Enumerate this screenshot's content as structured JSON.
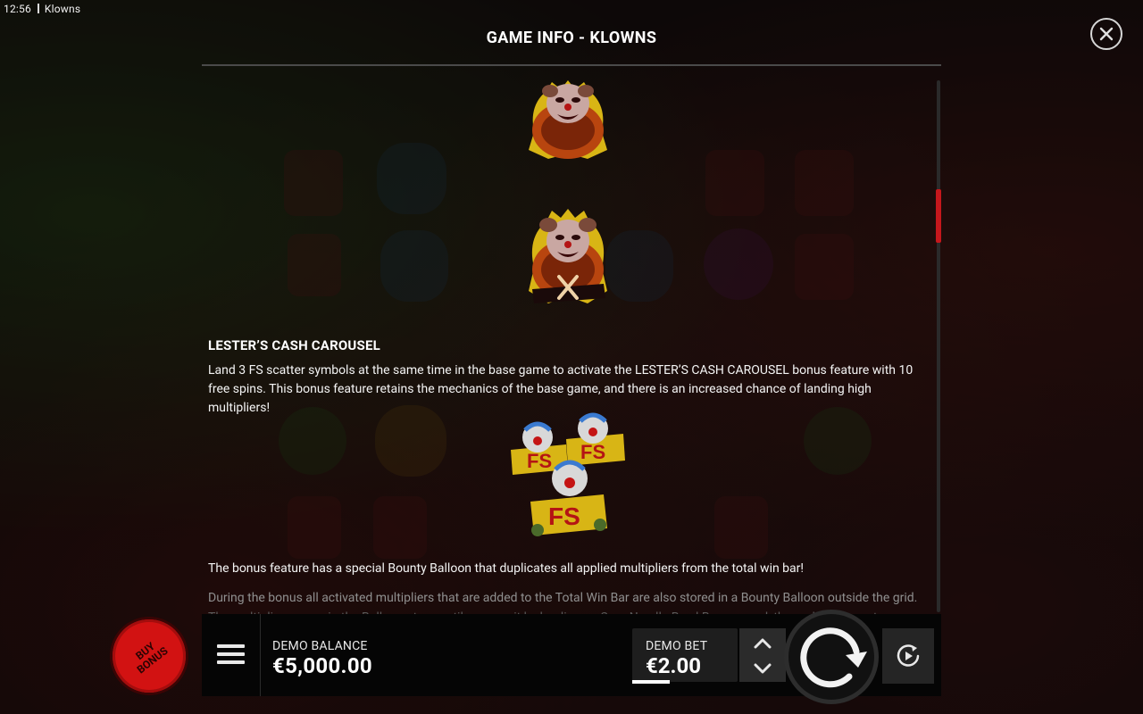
{
  "status_bar": {
    "time": "12:56",
    "app_name": "Klowns"
  },
  "header": {
    "title": "GAME INFO - KLOWNS",
    "close_icon": "close-icon"
  },
  "content": {
    "section_title": "LESTER’S CASH CAROUSEL",
    "paragraph_1": "Land 3 FS scatter symbols at the same time in the base game to activate the LESTER’S CASH CAROUSEL bonus feature with 10 free spins. This bonus feature retains the mechanics of the base game, and there is an increased chance of landing high multipliers!",
    "paragraph_2": "The bonus feature has a special Bounty Balloon that duplicates all applied multipliers from the total win bar!",
    "paragraph_3": "During the bonus all activated multipliers that are added to the Total Win Bar are also stored in a Bounty Balloon outside the grid.",
    "paragraph_4": "The multiplier ensure in the Balloon stays until you pop it by landing an Sour Needle Bowl Bars scored, the multiplier reset.",
    "symbols": [
      "clown-symbol",
      "clown-x-symbol",
      "fs-scatter-symbol"
    ],
    "fs_label": "FS",
    "x_mark": "X"
  },
  "bottom_bar": {
    "balance_label": "DEMO BALANCE",
    "balance_value": "€5,000.00",
    "bet_label": "DEMO BET",
    "bet_value": "€2.00"
  },
  "buy_bonus": {
    "label_line1": "BUY",
    "label_line2": "BONUS"
  },
  "colors": {
    "accent_red": "#c5171c",
    "buy_bonus_red": "#d21212",
    "background": "#120c0c"
  }
}
